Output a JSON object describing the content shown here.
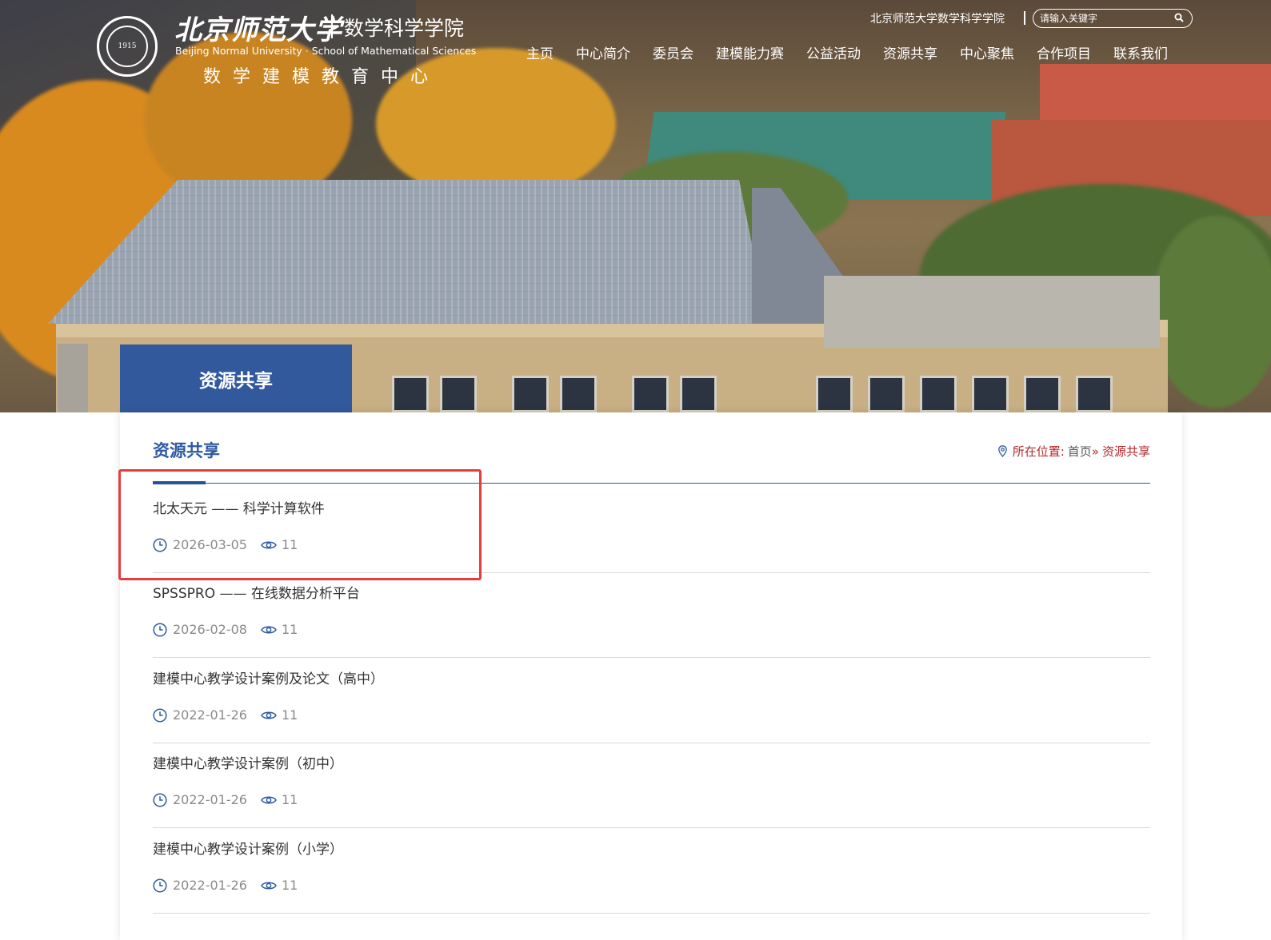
{
  "header": {
    "university_cn": "北京师范大学",
    "school_cn": "数学科学学院",
    "english_name": "Beijing Normal University · School of Mathematical Sciences",
    "center_name": "数学建模教育中心",
    "seal_year": "1915",
    "top_link": "北京师范大学数学科学学院",
    "search_placeholder": "请输入关键字"
  },
  "nav": {
    "items": [
      "主页",
      "中心简介",
      "委员会",
      "建模能力赛",
      "公益活动",
      "资源共享",
      "中心聚焦",
      "合作项目",
      "联系我们"
    ]
  },
  "banner": {
    "section_tab": "资源共享"
  },
  "content": {
    "section_title": "资源共享",
    "breadcrumb": {
      "label": "所在位置:",
      "home": "首页",
      "separator": "»",
      "current": "资源共享"
    },
    "items": [
      {
        "title": "北太天元 —— 科学计算软件",
        "date": "2026-03-05",
        "views": "11"
      },
      {
        "title": "SPSSPRO —— 在线数据分析平台",
        "date": "2026-02-08",
        "views": "11"
      },
      {
        "title": "建模中心教学设计案例及论文（高中）",
        "date": "2022-01-26",
        "views": "11"
      },
      {
        "title": "建模中心教学设计案例（初中）",
        "date": "2022-01-26",
        "views": "11"
      },
      {
        "title": "建模中心教学设计案例（小学）",
        "date": "2022-01-26",
        "views": "11"
      }
    ]
  },
  "colors": {
    "accent_blue": "#2d5aa0",
    "breadcrumb_red": "#b3272b",
    "highlight_red": "#e83b3b"
  }
}
